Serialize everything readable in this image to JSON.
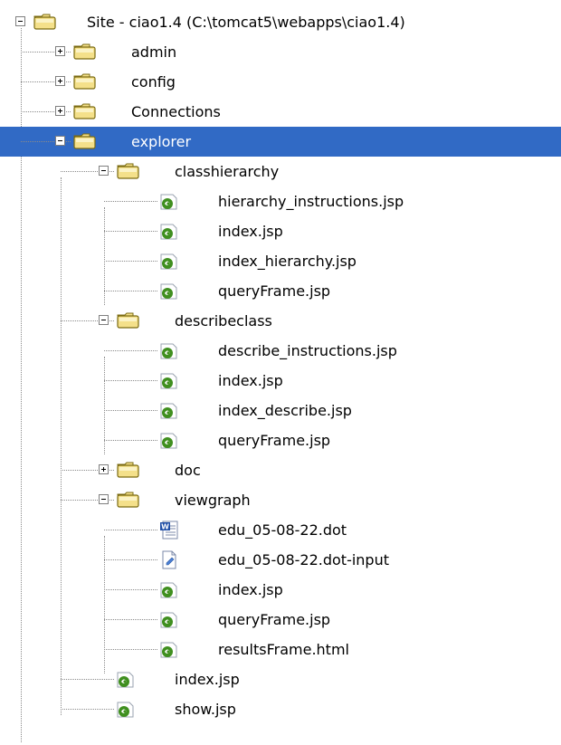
{
  "tree": [
    {
      "label": "Site - ciao1.4 (C:\\tomcat5\\webapps\\ciao1.4)",
      "type": "site",
      "depth": 0,
      "expander": "expanded",
      "selected": false
    },
    {
      "label": "admin",
      "type": "folder",
      "depth": 1,
      "expander": "collapsed",
      "selected": false
    },
    {
      "label": "config",
      "type": "folder",
      "depth": 1,
      "expander": "collapsed",
      "selected": false
    },
    {
      "label": "Connections",
      "type": "folder",
      "depth": 1,
      "expander": "collapsed",
      "selected": false
    },
    {
      "label": "explorer",
      "type": "folder",
      "depth": 1,
      "expander": "expanded",
      "selected": true
    },
    {
      "label": "classhierarchy",
      "type": "folder",
      "depth": 2,
      "expander": "expanded",
      "selected": false
    },
    {
      "label": "hierarchy_instructions.jsp",
      "type": "jsp",
      "depth": 3,
      "expander": null,
      "selected": false
    },
    {
      "label": "index.jsp",
      "type": "jsp",
      "depth": 3,
      "expander": null,
      "selected": false
    },
    {
      "label": "index_hierarchy.jsp",
      "type": "jsp",
      "depth": 3,
      "expander": null,
      "selected": false
    },
    {
      "label": "queryFrame.jsp",
      "type": "jsp",
      "depth": 3,
      "expander": null,
      "selected": false
    },
    {
      "label": "describeclass",
      "type": "folder",
      "depth": 2,
      "expander": "expanded",
      "selected": false
    },
    {
      "label": "describe_instructions.jsp",
      "type": "jsp",
      "depth": 3,
      "expander": null,
      "selected": false
    },
    {
      "label": "index.jsp",
      "type": "jsp",
      "depth": 3,
      "expander": null,
      "selected": false
    },
    {
      "label": "index_describe.jsp",
      "type": "jsp",
      "depth": 3,
      "expander": null,
      "selected": false
    },
    {
      "label": "queryFrame.jsp",
      "type": "jsp",
      "depth": 3,
      "expander": null,
      "selected": false
    },
    {
      "label": "doc",
      "type": "folder",
      "depth": 2,
      "expander": "collapsed",
      "selected": false
    },
    {
      "label": "viewgraph",
      "type": "folder",
      "depth": 2,
      "expander": "expanded",
      "selected": false
    },
    {
      "label": "edu_05-08-22.dot",
      "type": "word",
      "depth": 3,
      "expander": null,
      "selected": false
    },
    {
      "label": "edu_05-08-22.dot-input",
      "type": "text",
      "depth": 3,
      "expander": null,
      "selected": false
    },
    {
      "label": "index.jsp",
      "type": "jsp",
      "depth": 3,
      "expander": null,
      "selected": false
    },
    {
      "label": "queryFrame.jsp",
      "type": "jsp",
      "depth": 3,
      "expander": null,
      "selected": false
    },
    {
      "label": "resultsFrame.html",
      "type": "jsp",
      "depth": 3,
      "expander": null,
      "selected": false
    },
    {
      "label": "index.jsp",
      "type": "jsp",
      "depth": 2,
      "expander": null,
      "selected": false
    },
    {
      "label": "show.jsp",
      "type": "jsp",
      "depth": 2,
      "expander": null,
      "selected": false
    }
  ],
  "icons": {
    "site": "site-folder-icon",
    "folder": "folder-icon",
    "jsp": "jsp-file-icon",
    "word": "word-document-icon",
    "text": "text-document-icon"
  },
  "colors": {
    "selection": "#316ac5",
    "selection_text": "#ffffff",
    "folder_fill": "#f4e08a",
    "folder_outline": "#7a6a10",
    "jsp_green": "#3f8f1f",
    "connector": "#8a8a8a"
  }
}
